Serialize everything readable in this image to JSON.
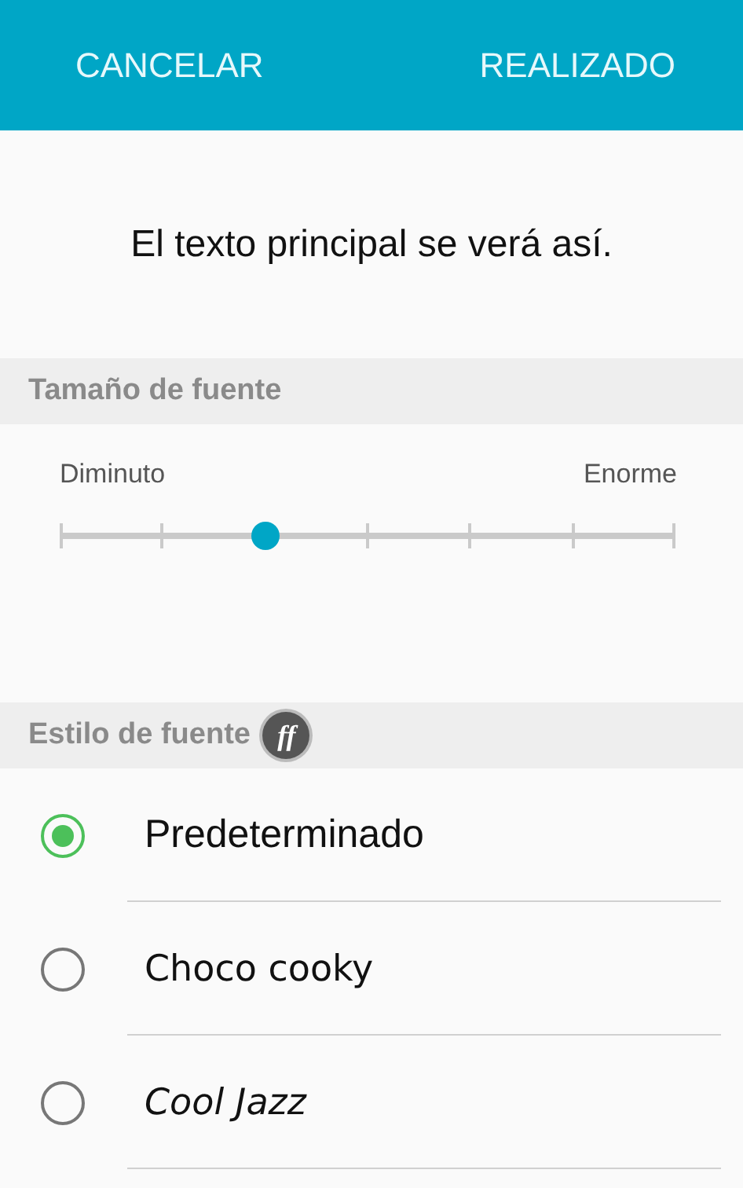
{
  "header": {
    "cancel": "CANCELAR",
    "done": "REALIZADO"
  },
  "preview": "El texto principal se verá así.",
  "font_size": {
    "heading": "Tamaño de fuente",
    "min_label": "Diminuto",
    "max_label": "Enorme",
    "level": 0.3333
  },
  "font_style": {
    "heading": "Estilo de fuente",
    "badge": "ff",
    "options": [
      {
        "label": "Predeterminado",
        "selected": true
      },
      {
        "label": "Choco cooky",
        "selected": false
      },
      {
        "label": "Cool Jazz",
        "selected": false
      }
    ]
  }
}
